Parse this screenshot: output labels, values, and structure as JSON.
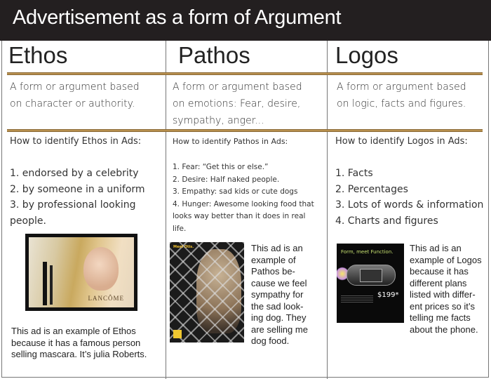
{
  "title": "Advertisement as a form of Argument",
  "columns": [
    {
      "heading": "Ethos",
      "definition": [
        "A form or argument based",
        "on character or authority."
      ],
      "how_heading": "How to identify Ethos in Ads:",
      "list": [
        "1. endorsed by a celebrity",
        "2. by someone in a uniform",
        "3. by professional looking",
        "people."
      ],
      "ad": {
        "brand_text": "LANCÔME",
        "icon": "mascara-ad-image"
      },
      "caption": [
        "This ad is an example of Ethos",
        "because it has a famous person",
        "selling mascara. It’s julia Roberts."
      ]
    },
    {
      "heading": "Pathos",
      "definition": [
        "A form or argument based",
        "on emotions: Fear, desire,",
        "sympathy, anger..."
      ],
      "how_heading": "How to identify Pathos in Ads:",
      "list": [
        "1. Fear: “Get this or else.”",
        "2. Desire: Half naked people.",
        "3. Empathy: sad kids or cute dogs",
        "4. Hunger: Awesome looking food that",
        "looks way better than it does in real",
        "life."
      ],
      "ad": {
        "headline_text": "Meet Otis.",
        "icon": "dog-food-ad-image"
      },
      "caption": [
        "This ad is an",
        "example of",
        "Pathos be-",
        "cause we feel",
        "sympathy for",
        "the sad look-",
        "ing dog. They",
        "are selling me",
        "dog food."
      ]
    },
    {
      "heading": "Logos",
      "definition": [
        "A form or argument based",
        "on logic, facts and figures."
      ],
      "how_heading": "How to identify Logos in Ads:",
      "list": [
        "1. Facts",
        "2. Percentages",
        "3. Lots of words & information",
        "4. Charts and figures"
      ],
      "ad": {
        "headline_text": "Form, meet Function.",
        "price_text": "$199*",
        "icon": "phone-ad-image"
      },
      "caption": [
        "This ad is an",
        "example of Logos",
        "because it has",
        "different plans",
        "listed with differ-",
        "ent prices so it’s",
        "telling me facts",
        "about the phone."
      ]
    }
  ],
  "colors": {
    "title_bar": "#231f20",
    "rule": "#b8904f",
    "border": "#777777"
  }
}
